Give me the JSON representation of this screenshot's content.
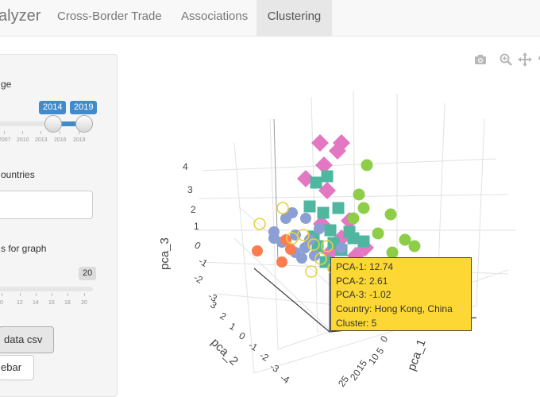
{
  "navbar": {
    "brand": "alyzer",
    "tabs": [
      "Cross-Border Trade",
      "Associations",
      "Clustering"
    ],
    "active_tab": "Clustering"
  },
  "sidebar": {
    "range_label": "ge",
    "range_slider": {
      "from_label": "2014",
      "to_label": "2019",
      "ticks": [
        "2007",
        "2010",
        "2013",
        "2016",
        "2019"
      ]
    },
    "countries_label": "ountries",
    "countries_value": "",
    "graph_label": "s for graph",
    "graph_slider": {
      "value_label": "20",
      "ticks": [
        "0",
        "12",
        "14",
        "16",
        "18",
        "20"
      ]
    },
    "download_button": "data csv",
    "sidebar_button": "ebar"
  },
  "modebar": {
    "icons": [
      "camera-icon",
      "zoom-icon",
      "pan-icon",
      "orbit-icon"
    ]
  },
  "chart_data": {
    "type": "scatter",
    "title": "",
    "axes": {
      "x": {
        "label": "pca_1",
        "ticks": [
          "0",
          "5",
          "10",
          "15",
          "20",
          "25"
        ]
      },
      "y": {
        "label": "pca_2",
        "ticks": [
          "-4",
          "-3",
          "-2",
          "-1",
          "0",
          "1",
          "2",
          "3"
        ]
      },
      "z": {
        "label": "pca_3",
        "ticks": [
          "-3",
          "-2",
          "-1",
          "0",
          "1",
          "2",
          "3",
          "4"
        ]
      }
    },
    "grid": true,
    "legend": "none",
    "series": [
      {
        "cluster": 1,
        "marker": "diamond",
        "color": "#e377c2"
      },
      {
        "cluster": 2,
        "marker": "circle",
        "color": "#8c9fd4"
      },
      {
        "cluster": 3,
        "marker": "square",
        "color": "#4fb7a0"
      },
      {
        "cluster": 4,
        "marker": "circle",
        "color": "#8dcd47"
      },
      {
        "cluster": 5,
        "marker": "circle-open",
        "color": "#e8d13c"
      },
      {
        "cluster": 6,
        "marker": "circle",
        "color": "#fb7d4f"
      }
    ],
    "hover": {
      "lines": [
        "PCA-1: 12.74",
        "PCA-2: 2.61",
        "PCA-3: -1.02",
        "Country: Hong Kong, China",
        "Cluster: 5"
      ],
      "color": "#fdd835"
    }
  }
}
